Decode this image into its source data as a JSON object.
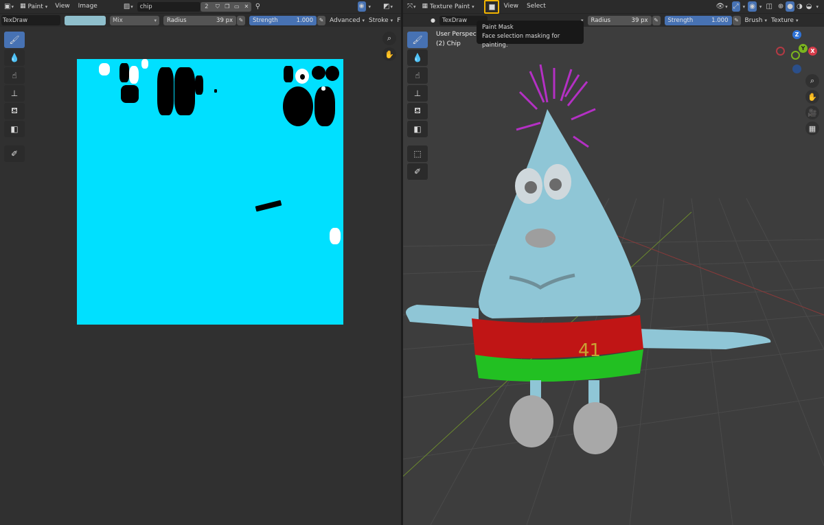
{
  "left_editor": {
    "header": {
      "mode_label": "Paint",
      "menus": [
        "View",
        "Image"
      ],
      "image_name": "chip",
      "users_count": "2"
    },
    "tool_settings": {
      "brush_name": "TexDraw",
      "color": "#8fbfcc",
      "blend_mode": "Mix",
      "radius_label": "Radius",
      "radius_value": "39 px",
      "strength_label": "Strength",
      "strength_value": "1.000",
      "strength_fraction": 1.0,
      "advanced_label": "Advanced",
      "stroke_label": "Stroke",
      "truncated_label": "F"
    },
    "image_fill_color": "#00e0ff"
  },
  "right_editor": {
    "header": {
      "mode_label": "Texture Paint",
      "menus": [
        "View",
        "Select"
      ]
    },
    "tool_settings": {
      "brush_name": "TexDraw",
      "radius_label": "Radius",
      "radius_value": "39 px",
      "strength_label": "Strength",
      "strength_value": "1.000",
      "strength_fraction": 1.0,
      "brush_label": "Brush",
      "texture_label": "Texture"
    },
    "viewport": {
      "view_name": "User Perspective",
      "object_label": "(2) Chip"
    },
    "tooltip": {
      "title": "Paint Mask",
      "description": "Face selection masking for painting."
    },
    "gizmo": {
      "x": "X",
      "y": "Y",
      "z": "Z"
    },
    "character_jersey_number": "41"
  },
  "colors": {
    "accent_blue": "#4772b3",
    "highlight_border": "#f2b400",
    "panel_bg": "#303030",
    "header_bg": "#2b2b2b"
  }
}
